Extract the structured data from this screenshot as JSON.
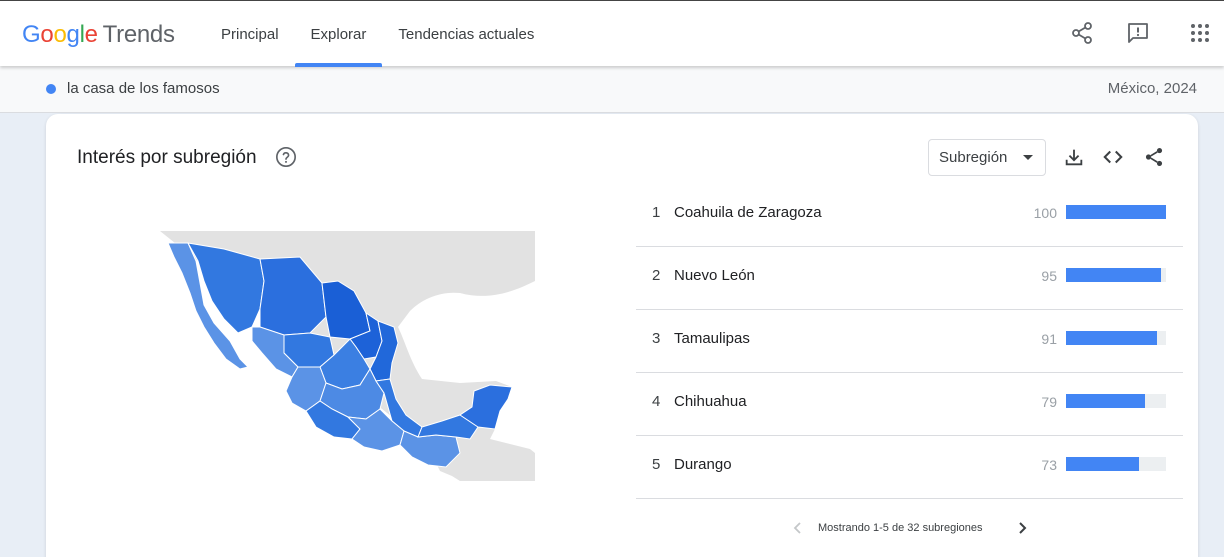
{
  "header": {
    "logo_google": [
      "G",
      "o",
      "o",
      "g",
      "l",
      "e"
    ],
    "logo_trends": "Trends",
    "tabs": [
      {
        "label": "Principal",
        "active": false
      },
      {
        "label": "Explorar",
        "active": true
      },
      {
        "label": "Tendencias actuales",
        "active": false
      }
    ],
    "icons": [
      "share-icon",
      "feedback-icon",
      "apps-grid-icon"
    ]
  },
  "query": {
    "term": "la casa de los famosos",
    "meta": "México, 2024",
    "color": "#4285f4"
  },
  "card": {
    "title": "Interés por subregión",
    "dropdown": {
      "selected": "Subregión"
    },
    "icons": [
      "download-icon",
      "embed-code-icon",
      "share-icon"
    ],
    "rankings": [
      {
        "rank": "1",
        "name": "Coahuila de Zaragoza",
        "value": 100
      },
      {
        "rank": "2",
        "name": "Nuevo León",
        "value": 95
      },
      {
        "rank": "3",
        "name": "Tamaulipas",
        "value": 91
      },
      {
        "rank": "4",
        "name": "Chihuahua",
        "value": 79
      },
      {
        "rank": "5",
        "name": "Durango",
        "value": 73
      }
    ],
    "pagination": "Mostrando 1-5 de 32 subregiones",
    "colors": {
      "bar": "#4285f4",
      "track": "#eceff1",
      "map_dark": "#1a5fd6",
      "map_mid": "#3278e0",
      "map_light": "#5b93e6",
      "map_bg": "#e2e2e2"
    }
  }
}
